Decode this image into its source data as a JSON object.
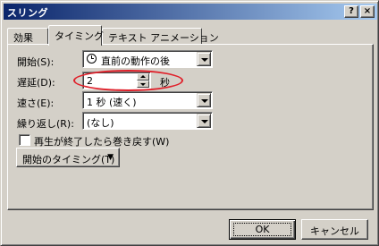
{
  "window": {
    "title": "スリング",
    "help_button": "?",
    "close_button": "×"
  },
  "tabs": [
    {
      "label": "効果",
      "active": false
    },
    {
      "label": "タイミング",
      "active": true
    },
    {
      "label": "テキスト アニメーション",
      "active": false
    }
  ],
  "timing": {
    "start": {
      "label": "開始(S):",
      "value": "直前の動作の後",
      "icon": "clock-icon"
    },
    "delay": {
      "label": "遅延(D):",
      "value": "2",
      "unit": "秒"
    },
    "speed": {
      "label": "速さ(E):",
      "value": "1 秒 (速く)"
    },
    "repeat": {
      "label": "繰り返し(R):",
      "value": "(なし)"
    },
    "rewind": {
      "label": "再生が終了したら巻き戻す(W)",
      "checked": false
    },
    "triggers_button": {
      "label": "開始のタイミング(T)",
      "arrow": "▼"
    }
  },
  "footer": {
    "ok_label": "OK",
    "cancel_label": "キャンセル"
  },
  "colors": {
    "highlight_oval": "#e0202a",
    "titlebar_start": "#0a246a",
    "titlebar_end": "#a6caf0"
  }
}
